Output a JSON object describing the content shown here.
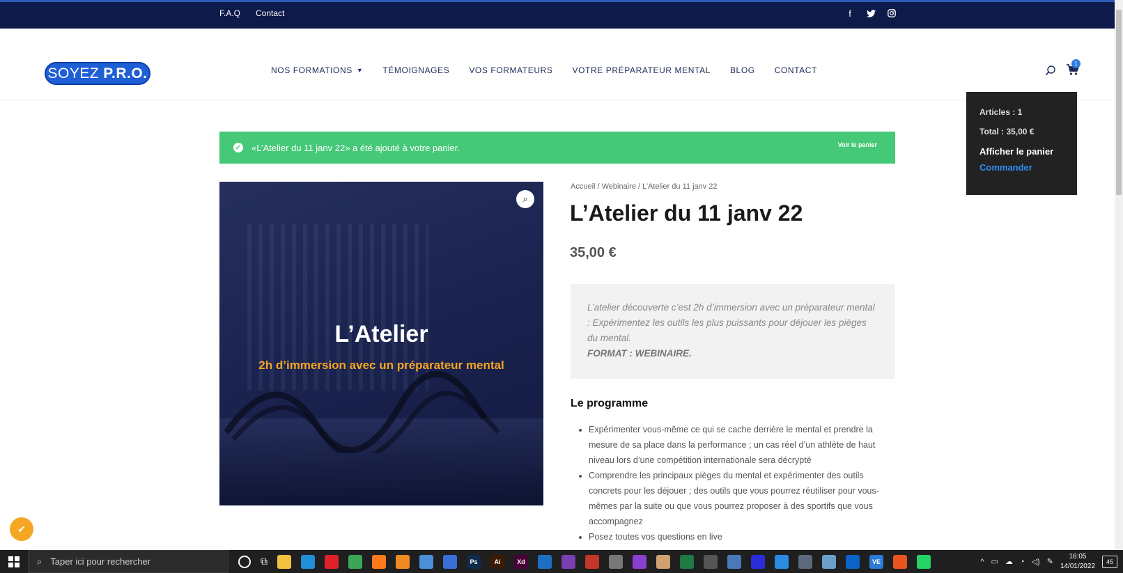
{
  "topbar": {
    "links": [
      "F.A.Q",
      "Contact"
    ],
    "social_icons": [
      "facebook-icon",
      "twitter-icon",
      "instagram-icon"
    ]
  },
  "header": {
    "logo": {
      "text_a": "SOYEZ",
      "text_b": "P.R.O."
    },
    "nav": [
      {
        "label": "NOS FORMATIONS",
        "has_dropdown": true
      },
      {
        "label": "TÉMOIGNAGES"
      },
      {
        "label": "VOS FORMATEURS"
      },
      {
        "label": "VOTRE PRÉPARATEUR MENTAL"
      },
      {
        "label": "BLOG"
      },
      {
        "label": "CONTACT"
      }
    ],
    "cart_count": "1"
  },
  "minicart": {
    "articles": "Articles : 1",
    "total": "Total : 35,00 €",
    "show_cart": "Afficher le panier",
    "checkout": "Commander"
  },
  "notice": {
    "message": "«L’Atelier du 11 janv 22» a été ajouté à votre panier.",
    "view_cart": "Voir le panier"
  },
  "product": {
    "image_title": "L’Atelier",
    "image_subtitle": "2h d’immersion avec un préparateur mental",
    "breadcrumb": "Accueil / Webinaire / L’Atelier du 11 janv 22",
    "title": "L’Atelier du 11 janv 22",
    "price": "35,00 €",
    "short_description": "L’atelier découverte c’est 2h d’immersion avec un préparateur mental : Expérimentez les outils les plus puissants pour déjouer les pièges du mental.",
    "format": "FORMAT : WEBINAIRE.",
    "program_heading": "Le programme",
    "program": [
      "Expérimenter vous-même ce qui se cache derrière le mental et prendre la mesure de sa place dans la performance ; un cas réel d’un athlète de haut niveau lors d’une compétition internationale sera décrypté",
      "Comprendre les principaux pièges du mental et expérimenter des outils concrets pour les déjouer ; des outils que vous pourrez réutiliser pour vous-mêmes par la suite ou que vous pourrez proposer à des sportifs que vous accompagnez",
      "Posez toutes vos questions en live"
    ]
  },
  "taskbar": {
    "search_placeholder": "Taper ici pour rechercher",
    "time": "16:05",
    "date": "14/01/2022",
    "notifications": "45",
    "apps": [
      {
        "name": "file-explorer-icon",
        "color": "#f3c140",
        "label": ""
      },
      {
        "name": "edge-icon",
        "color": "#1f8fd8",
        "label": ""
      },
      {
        "name": "opera-icon",
        "color": "#e0212b",
        "label": ""
      },
      {
        "name": "chrome-icon",
        "color": "#3aa757",
        "label": ""
      },
      {
        "name": "firefox-icon",
        "color": "#ff7a1a",
        "label": ""
      },
      {
        "name": "sublime-icon",
        "color": "#f08a24",
        "label": ""
      },
      {
        "name": "network-icon",
        "color": "#4a90d9",
        "label": ""
      },
      {
        "name": "remote-icon",
        "color": "#3a6fd8",
        "label": ""
      },
      {
        "name": "photoshop-icon",
        "color": "#0f2a4a",
        "label": "Ps"
      },
      {
        "name": "illustrator-icon",
        "color": "#3a1a00",
        "label": "Ai"
      },
      {
        "name": "xd-icon",
        "color": "#470137",
        "label": "Xd"
      },
      {
        "name": "affinity-designer-icon",
        "color": "#1d6fc4",
        "label": ""
      },
      {
        "name": "affinity-photo-icon",
        "color": "#7a3fb0",
        "label": ""
      },
      {
        "name": "affinity-publisher-icon",
        "color": "#c4352a",
        "label": ""
      },
      {
        "name": "alien-icon",
        "color": "#777777",
        "label": ""
      },
      {
        "name": "droplet-icon",
        "color": "#8b3fd0",
        "label": ""
      },
      {
        "name": "palette-icon",
        "color": "#d0a070",
        "label": ""
      },
      {
        "name": "excel-sheet-icon",
        "color": "#1f7a44",
        "label": ""
      },
      {
        "name": "gamepad-icon",
        "color": "#555555",
        "label": ""
      },
      {
        "name": "scanner-icon",
        "color": "#4a78b8",
        "label": ""
      },
      {
        "name": "amazon-music-icon",
        "color": "#2b2dd8",
        "label": ""
      },
      {
        "name": "safari-icon",
        "color": "#2a8ce0",
        "label": ""
      },
      {
        "name": "calculator-icon",
        "color": "#5a6a7a",
        "label": ""
      },
      {
        "name": "notes-icon",
        "color": "#6aa0c8",
        "label": ""
      },
      {
        "name": "outlook-icon",
        "color": "#0a64c8",
        "label": ""
      },
      {
        "name": "vs-code-icon",
        "color": "#2a7ad8",
        "label": "VE"
      },
      {
        "name": "ubuntu-icon",
        "color": "#e95420",
        "label": ""
      },
      {
        "name": "whatsapp-icon",
        "color": "#25d366",
        "label": ""
      }
    ]
  }
}
